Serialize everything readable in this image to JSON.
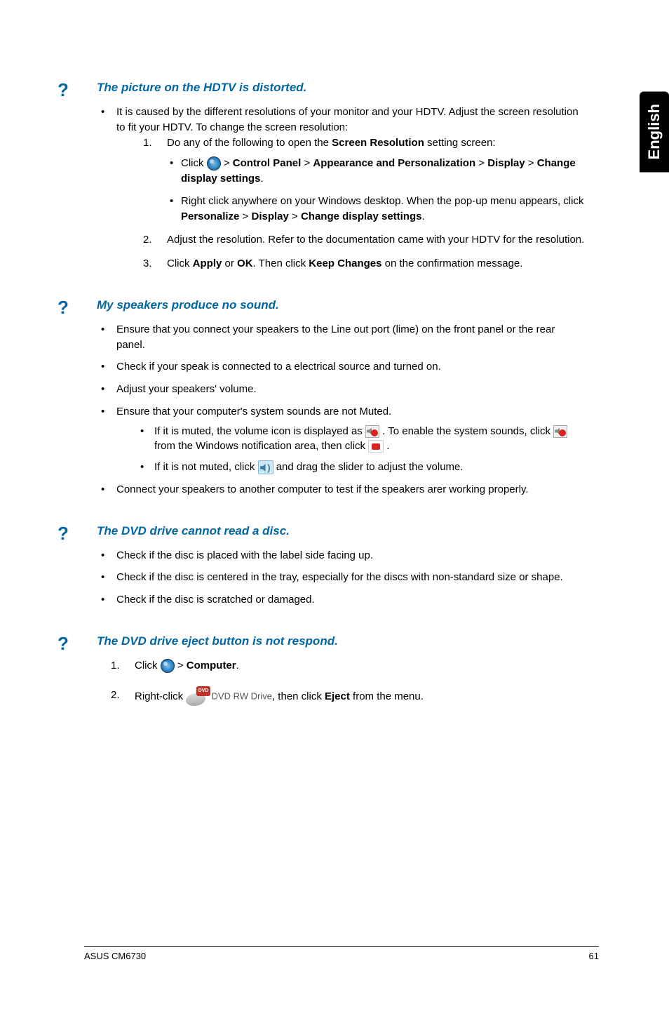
{
  "side_tab": "English",
  "sections": {
    "s1": {
      "heading": "The picture on the HDTV is distorted.",
      "intro": "It is caused by the different resolutions of your monitor and your HDTV. Adjust the screen resolution to fit your HDTV. To change the screen resolution:",
      "step1_intro": "Do any of the following to open the ",
      "step1_bold": "Screen Resolution",
      "step1_tail": " setting screen:",
      "opt1_a": "Click ",
      "opt1_b": " > ",
      "opt1_cp": "Control Panel",
      "opt1_c": " > ",
      "opt1_ap": "Appearance and Personalization",
      "opt1_d": " > ",
      "opt1_disp": "Display",
      "opt1_e": " > ",
      "opt1_cds": "Change display settings",
      "opt1_f": ".",
      "opt2_a": "Right click anywhere on your Windows desktop. When the pop-up menu appears, click ",
      "opt2_pers": "Personalize",
      "opt2_b": " > ",
      "opt2_disp": "Display",
      "opt2_c": " > ",
      "opt2_cds": "Change display settings",
      "opt2_d": ".",
      "step2": "Adjust the resolution. Refer to the documentation came with your HDTV for the resolution.",
      "step3_a": "Click ",
      "step3_apply": "Apply",
      "step3_b": " or ",
      "step3_ok": "OK",
      "step3_c": ". Then click ",
      "step3_kc": "Keep Changes",
      "step3_d": " on the confirmation message."
    },
    "s2": {
      "heading": "My speakers produce no sound.",
      "b1": "Ensure that you connect your speakers to the Line out port (lime) on the front panel or the rear panel.",
      "b2": "Check if your speak is connected to a electrical source and turned on.",
      "b3": "Adjust your speakers' volume.",
      "b4": "Ensure that your computer's system sounds are not Muted.",
      "b4s1_a": "If it is muted, the volume icon is displayed as ",
      "b4s1_b": " . To enable the system sounds, click ",
      "b4s1_c": " from the Windows notification area, then click ",
      "b4s1_d": " .",
      "b4s2_a": "If it is not muted, click ",
      "b4s2_b": " and drag the slider to adjust the volume.",
      "b5": "Connect your speakers to another computer to test if the speakers arer working properly."
    },
    "s3": {
      "heading": "The DVD drive cannot read a disc.",
      "b1": "Check if the disc is placed with the label side facing up.",
      "b2": "Check if the disc is centered in the tray, especially for the discs with non-standard size or shape.",
      "b3": "Check if the disc is scratched or damaged."
    },
    "s4": {
      "heading": "The DVD drive eject button is not respond.",
      "step1_a": "Click ",
      "step1_b": " > ",
      "step1_comp": "Computer",
      "step1_c": ".",
      "step2_a": "Right-click ",
      "dvd_label": "DVD RW Drive",
      "step2_b": ", then click ",
      "step2_eject": "Eject",
      "step2_c": " from the menu."
    }
  },
  "footer": {
    "left": "ASUS CM6730",
    "right": "61"
  }
}
